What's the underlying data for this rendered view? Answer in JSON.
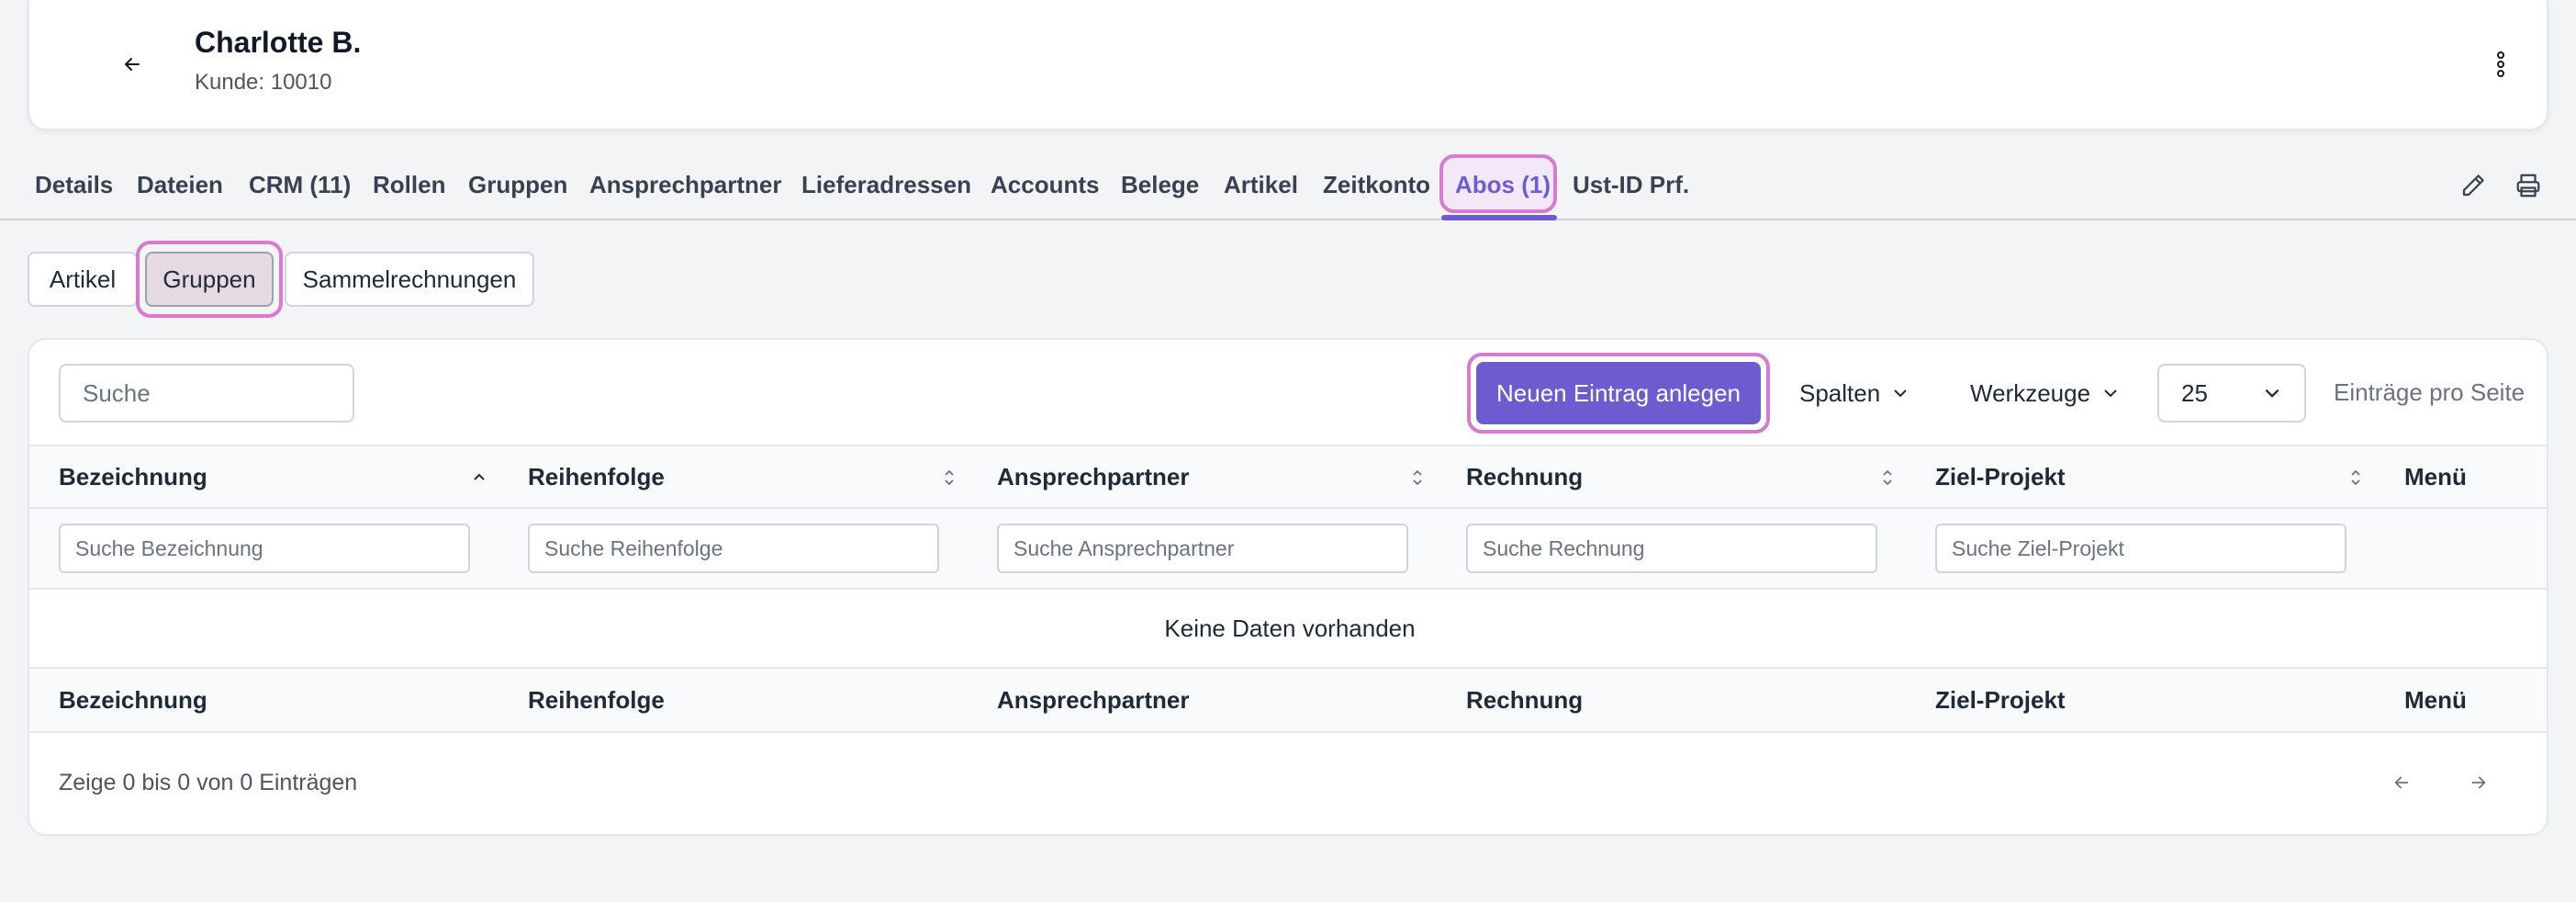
{
  "header": {
    "name": "Charlotte B.",
    "customer_line": "Kunde: 10010"
  },
  "tabs": [
    {
      "label": "Details"
    },
    {
      "label": "Dateien"
    },
    {
      "label": "CRM (11)"
    },
    {
      "label": "Rollen"
    },
    {
      "label": "Gruppen"
    },
    {
      "label": "Ansprechpartner"
    },
    {
      "label": "Lieferadressen"
    },
    {
      "label": "Accounts"
    },
    {
      "label": "Belege"
    },
    {
      "label": "Artikel"
    },
    {
      "label": "Zeitkonto"
    },
    {
      "label": "Abos (1)",
      "active": true
    },
    {
      "label": "Ust-ID Prf."
    }
  ],
  "subtabs": [
    {
      "label": "Artikel"
    },
    {
      "label": "Gruppen",
      "active": true
    },
    {
      "label": "Sammelrechnungen"
    }
  ],
  "toolbar": {
    "search_placeholder": "Suche",
    "new_entry": "Neuen Eintrag anlegen",
    "columns": "Spalten",
    "tools": "Werkzeuge",
    "page_size": "25",
    "per_page_label": "Einträge pro Seite"
  },
  "table": {
    "columns": [
      "Bezeichnung",
      "Reihenfolge",
      "Ansprechpartner",
      "Rechnung",
      "Ziel-Projekt",
      "Menü"
    ],
    "filters": [
      "Suche Bezeichnung",
      "Suche Reihenfolge",
      "Suche Ansprechpartner",
      "Suche Rechnung",
      "Suche Ziel-Projekt"
    ],
    "empty_text": "Keine Daten vorhanden",
    "info": "Zeige 0 bis 0 von 0 Einträgen"
  },
  "colors": {
    "accent": "#6d5bd0",
    "highlight": "#d87ad0"
  }
}
